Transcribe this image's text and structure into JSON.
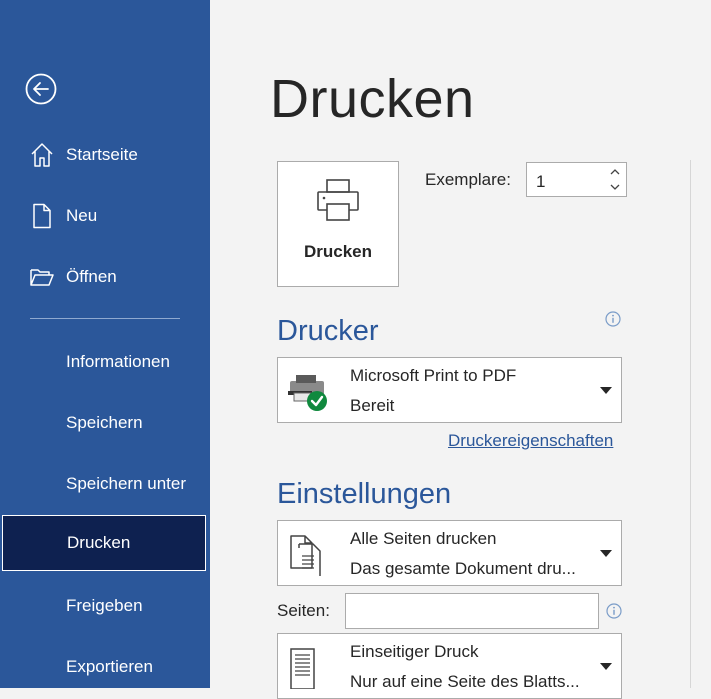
{
  "sidebar": {
    "items": [
      {
        "label": "Startseite",
        "icon": "home-icon"
      },
      {
        "label": "Neu",
        "icon": "new-document-icon"
      },
      {
        "label": "Öffnen",
        "icon": "open-folder-icon"
      },
      {
        "label": "Informationen"
      },
      {
        "label": "Speichern"
      },
      {
        "label": "Speichern unter"
      },
      {
        "label": "Drucken",
        "selected": true
      },
      {
        "label": "Freigeben"
      },
      {
        "label": "Exportieren"
      }
    ],
    "bg_color": "#2b579a",
    "selected_color": "#0e2150"
  },
  "main": {
    "title": "Drucken",
    "print_button": {
      "label": "Drucken",
      "icon": "printer-icon"
    },
    "copies": {
      "label": "Exemplare:",
      "value": "1"
    },
    "printer_section": {
      "heading": "Drucker",
      "printer_name": "Microsoft Print to PDF",
      "status": "Bereit",
      "properties_link": "Druckereigenschaften"
    },
    "settings_section": {
      "heading": "Einstellungen",
      "pages_range": {
        "line1": "Alle Seiten drucken",
        "line2": "Das gesamte Dokument dru..."
      },
      "pages_label": "Seiten:",
      "pages_value": "",
      "sides": {
        "line1": "Einseitiger Druck",
        "line2": "Nur auf eine Seite des Blatts..."
      }
    },
    "accent_color": "#2b579a"
  }
}
